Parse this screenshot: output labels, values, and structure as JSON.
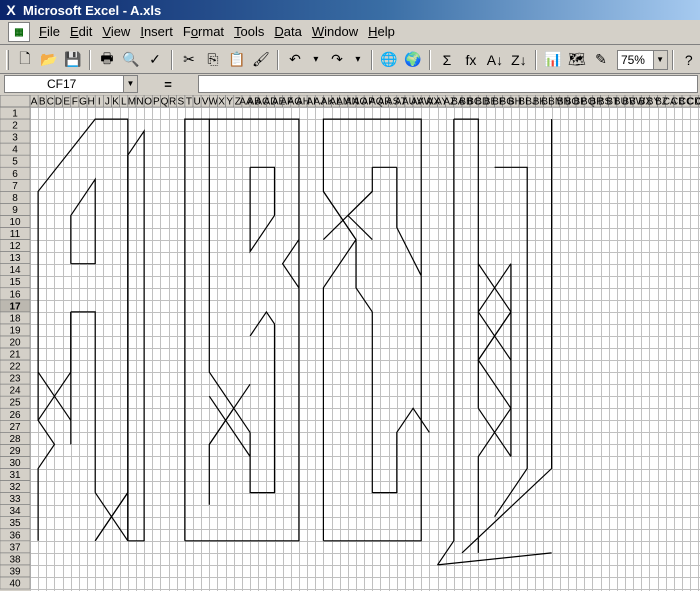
{
  "window": {
    "title": "Microsoft Excel - A.xls",
    "app_icon": "X"
  },
  "menu": {
    "doc_icon": "xls-document-icon",
    "items": [
      {
        "label": "File",
        "hotkey_index": 0
      },
      {
        "label": "Edit",
        "hotkey_index": 0
      },
      {
        "label": "View",
        "hotkey_index": 0
      },
      {
        "label": "Insert",
        "hotkey_index": 0
      },
      {
        "label": "Format",
        "hotkey_index": 1
      },
      {
        "label": "Tools",
        "hotkey_index": 0
      },
      {
        "label": "Data",
        "hotkey_index": 0
      },
      {
        "label": "Window",
        "hotkey_index": 0
      },
      {
        "label": "Help",
        "hotkey_index": 0
      }
    ]
  },
  "toolbar": {
    "buttons": [
      {
        "name": "new-icon",
        "glyph": "🗋"
      },
      {
        "name": "open-icon",
        "glyph": "📂"
      },
      {
        "name": "save-icon",
        "glyph": "💾"
      },
      {
        "sep": true
      },
      {
        "name": "print-icon",
        "glyph": "🖶"
      },
      {
        "name": "print-preview-icon",
        "glyph": "🔍"
      },
      {
        "name": "spelling-icon",
        "glyph": "✓"
      },
      {
        "sep": true
      },
      {
        "name": "cut-icon",
        "glyph": "✂"
      },
      {
        "name": "copy-icon",
        "glyph": "⎘"
      },
      {
        "name": "paste-icon",
        "glyph": "📋"
      },
      {
        "name": "format-painter-icon",
        "glyph": "🖌"
      },
      {
        "sep": true
      },
      {
        "name": "undo-icon",
        "glyph": "↶"
      },
      {
        "name": "undo-dropdown-icon",
        "glyph": "▾",
        "small": true
      },
      {
        "name": "redo-icon",
        "glyph": "↷"
      },
      {
        "name": "redo-dropdown-icon",
        "glyph": "▾",
        "small": true
      },
      {
        "sep": true
      },
      {
        "name": "insert-hyperlink-icon",
        "glyph": "🌐"
      },
      {
        "name": "web-toolbar-icon",
        "glyph": "🌍"
      },
      {
        "sep": true
      },
      {
        "name": "autosum-icon",
        "glyph": "Σ"
      },
      {
        "name": "paste-function-icon",
        "glyph": "fx"
      },
      {
        "name": "sort-ascending-icon",
        "glyph": "A↓"
      },
      {
        "name": "sort-descending-icon",
        "glyph": "Z↓"
      },
      {
        "sep": true
      },
      {
        "name": "chart-wizard-icon",
        "glyph": "📊"
      },
      {
        "name": "map-icon",
        "glyph": "🗺"
      },
      {
        "name": "drawing-icon",
        "glyph": "✎"
      }
    ],
    "zoom": "75%",
    "help_icon": "office-assistant-icon"
  },
  "formula_bar": {
    "name_box": "CF17",
    "equals": "=",
    "formula": ""
  },
  "sheet": {
    "selected_row": 17,
    "columns": [
      "A",
      "B",
      "C",
      "D",
      "E",
      "F",
      "G",
      "H",
      "I",
      "J",
      "K",
      "L",
      "M",
      "N",
      "O",
      "P",
      "Q",
      "R",
      "S",
      "T",
      "U",
      "V",
      "W",
      "X",
      "Y",
      "Z",
      "AA",
      "AB",
      "AC",
      "AD",
      "AE",
      "AF",
      "AG",
      "AH",
      "AI",
      "AJ",
      "AK",
      "AL",
      "AM",
      "AN",
      "AO",
      "AP",
      "AQ",
      "AR",
      "AS",
      "AT",
      "AU",
      "AV",
      "AW",
      "AX",
      "AY",
      "AZ",
      "BA",
      "BB",
      "BC",
      "BD",
      "BE",
      "BF",
      "BG",
      "BH",
      "BI",
      "BJ",
      "BK",
      "BL",
      "BM",
      "BN",
      "BO",
      "BP",
      "BQ",
      "BR",
      "BS",
      "BT",
      "BU",
      "BV",
      "BW",
      "BX",
      "BY",
      "BZ",
      "CA",
      "CB",
      "CC",
      "CD",
      "CE",
      "CF",
      "CG",
      "CH",
      "CI",
      "CJ",
      "CK",
      "CL",
      "CM",
      "CN"
    ],
    "rows": [
      1,
      2,
      3,
      4,
      5,
      6,
      7,
      8,
      9,
      10,
      11,
      12,
      13,
      14,
      15,
      16,
      17,
      18,
      19,
      20,
      21,
      22,
      23,
      24,
      25,
      26,
      27,
      28,
      29,
      30,
      31,
      32,
      33,
      34,
      35,
      36,
      37,
      38,
      39,
      40
    ]
  }
}
